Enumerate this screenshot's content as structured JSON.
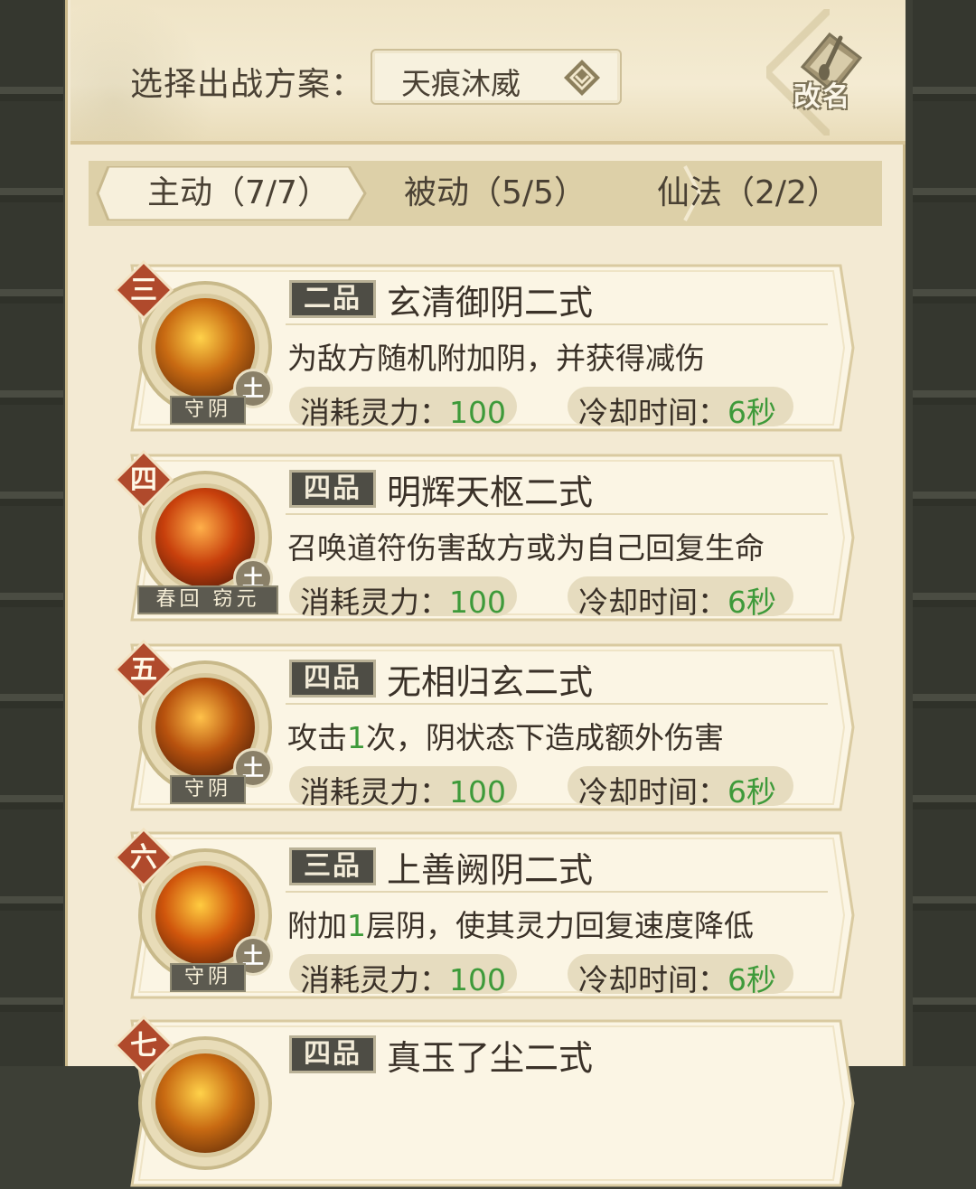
{
  "header": {
    "plan_label": "选择出战方案：",
    "plan_value": "天痕沐威",
    "rename_label": "改名"
  },
  "tabs": [
    {
      "label": "主动（7/7）",
      "active": true
    },
    {
      "label": "被动（5/5）",
      "active": false
    },
    {
      "label": "仙法（2/2）",
      "active": false
    }
  ],
  "stat_labels": {
    "cost": "消耗灵力：",
    "cooldown": "冷却时间："
  },
  "skills": [
    {
      "rank": "三",
      "grade": "二品",
      "name": "玄清御阴二式",
      "desc_parts": [
        "为敌方随机附加阴，并获得减伤"
      ],
      "element": "土",
      "tag": "守阴",
      "cost": "100",
      "cooldown": "6秒"
    },
    {
      "rank": "四",
      "grade": "四品",
      "name": "明辉天枢二式",
      "desc_parts": [
        "召唤道符伤害敌方或为自己回复生命"
      ],
      "element": "土",
      "tag": "春回 窃元",
      "cost": "100",
      "cooldown": "6秒"
    },
    {
      "rank": "五",
      "grade": "四品",
      "name": "无相归玄二式",
      "desc_parts": [
        "攻击",
        "1",
        "次，阴状态下造成额外伤害"
      ],
      "element": "土",
      "tag": "守阴",
      "cost": "100",
      "cooldown": "6秒"
    },
    {
      "rank": "六",
      "grade": "三品",
      "name": "上善阙阴二式",
      "desc_parts": [
        "附加",
        "1",
        "层阴，使其灵力回复速度降低"
      ],
      "element": "土",
      "tag": "守阴",
      "cost": "100",
      "cooldown": "6秒"
    },
    {
      "rank": "七",
      "grade": "四品",
      "name": "真玉了尘二式"
    }
  ],
  "colors": {
    "accent_green": "#3e9a3a",
    "rank_red": "#b04a2c",
    "panel": "#f3ead3"
  }
}
